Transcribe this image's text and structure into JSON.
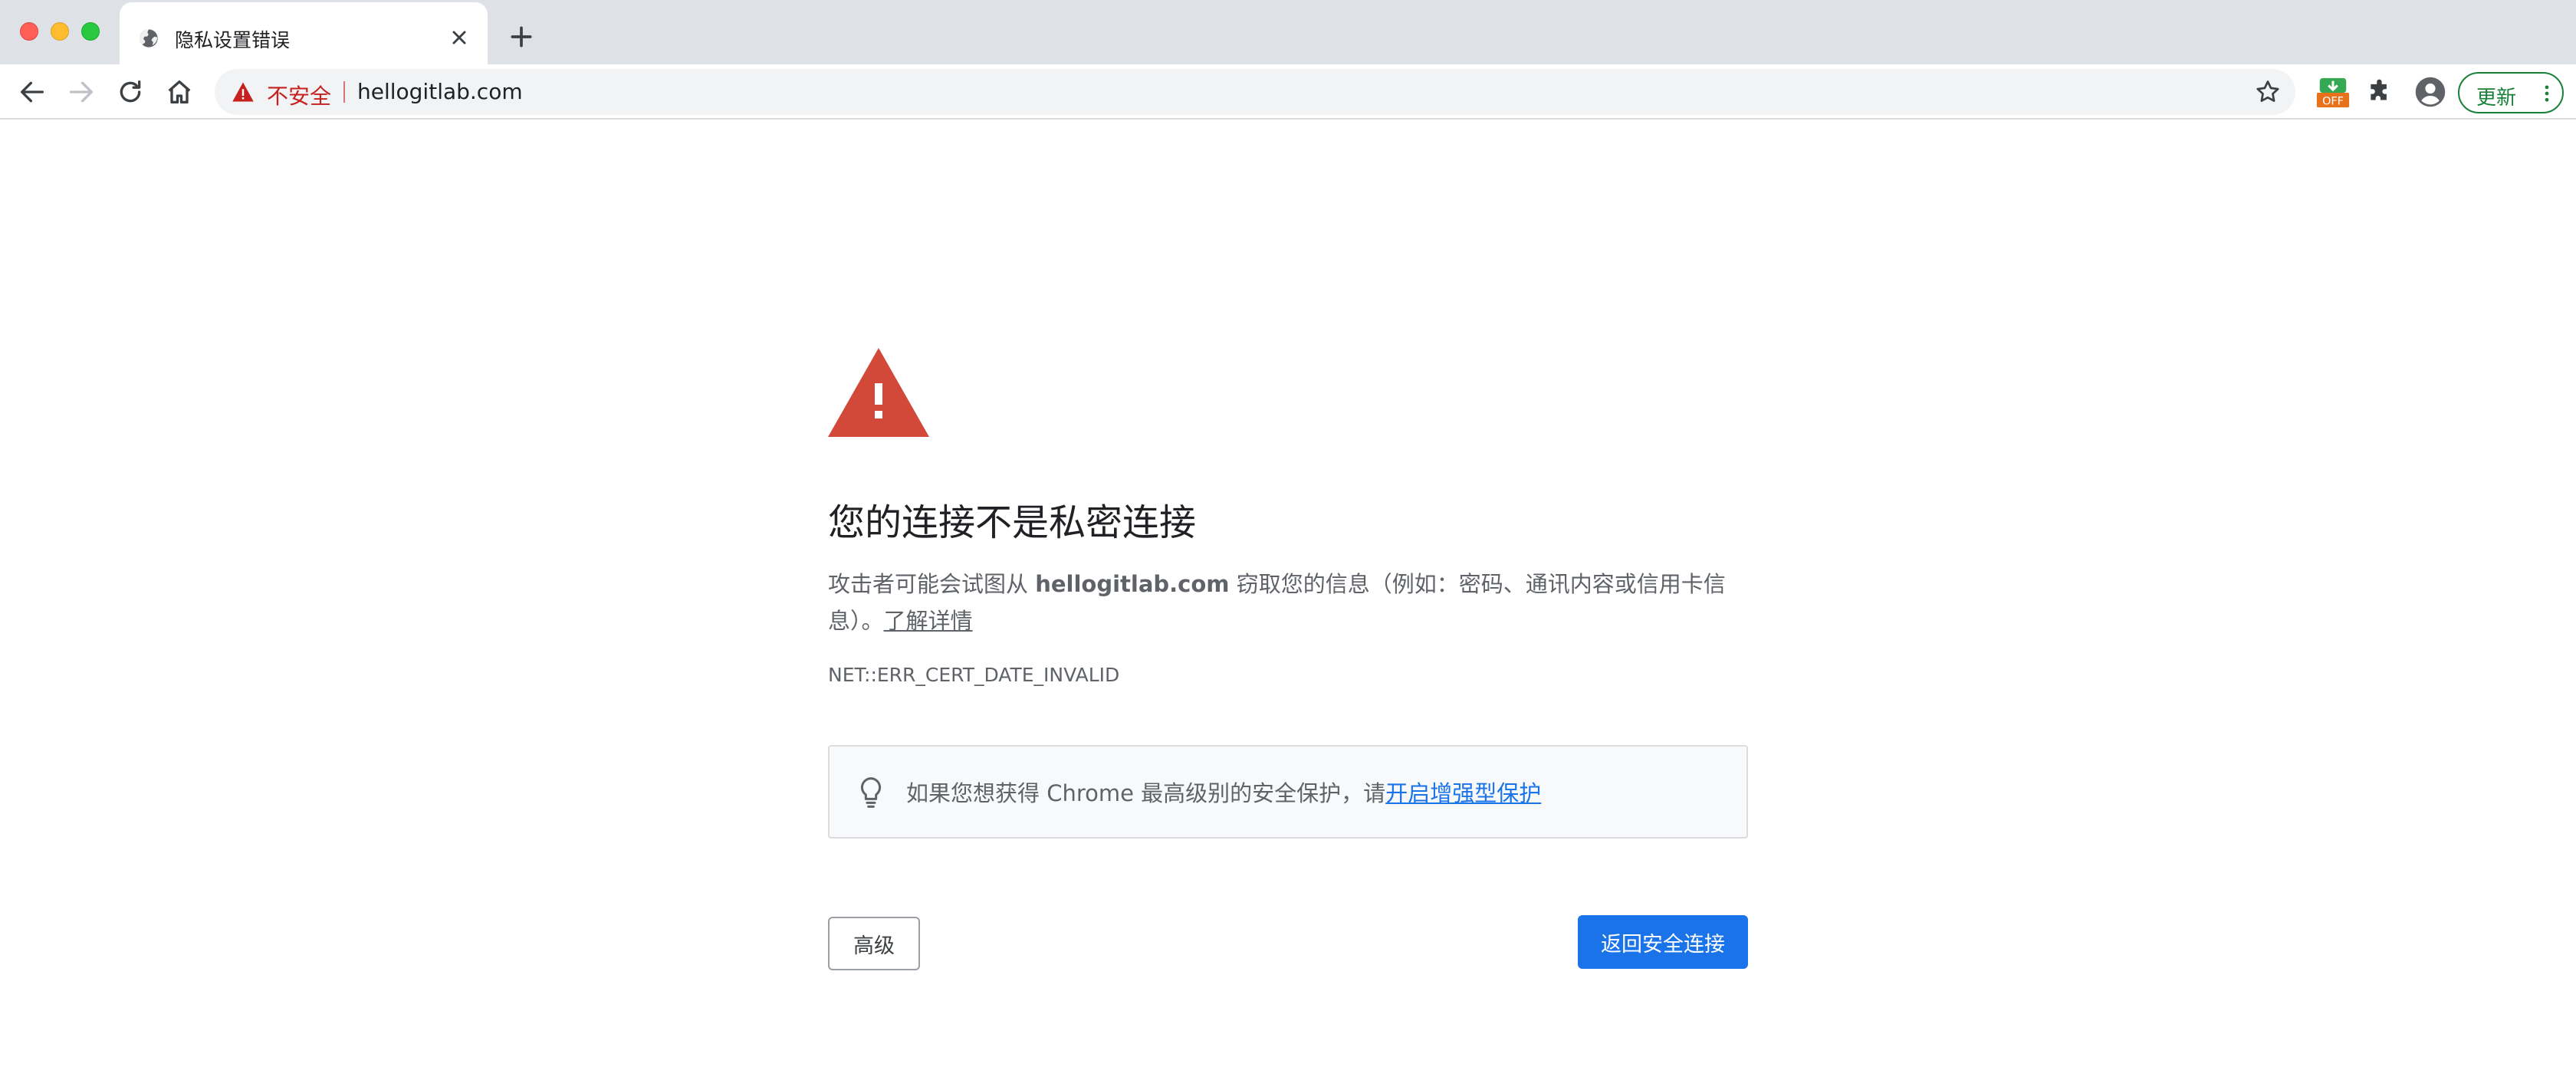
{
  "browser": {
    "tab": {
      "title": "隐私设置错误",
      "favicon": "globe-icon",
      "close_icon": "close-icon"
    },
    "new_tab_icon": "plus-icon",
    "toolbar": {
      "back_icon": "back-arrow-icon",
      "forward_icon": "forward-arrow-icon",
      "reload_icon": "reload-icon",
      "home_icon": "home-icon"
    },
    "omnibox": {
      "security_icon": "warning-triangle-icon",
      "security_label": "不安全",
      "url": "hellogitlab.com",
      "bookmark_icon": "star-icon"
    },
    "extensions": {
      "ext_badge": "OFF",
      "puzzle_icon": "puzzle-icon"
    },
    "profile_icon": "account-circle-icon",
    "update_button": {
      "label": "更新",
      "menu_icon": "kebab-menu-icon"
    }
  },
  "interstitial": {
    "icon": "warning-triangle-icon",
    "heading": "您的连接不是私密连接",
    "explanation_prefix": "攻击者可能会试图从 ",
    "explanation_host": "hellogitlab.com",
    "explanation_suffix": " 窃取您的信息（例如：密码、通讯内容或信用卡信息）。",
    "learn_more": "了解详情",
    "error_code": "NET::ERR_CERT_DATE_INVALID",
    "promo": {
      "icon": "lightbulb-icon",
      "text": "如果您想获得 Chrome 最高级别的安全保护，请",
      "link": "开启增强型保护"
    },
    "advanced_button": "高级",
    "back_button": "返回安全连接"
  },
  "colors": {
    "danger": "#c5221f",
    "warning_triangle": "#d2493a",
    "primary_blue": "#1a73e8",
    "update_green": "#188038",
    "tabstrip_bg": "#dee1e6",
    "text_secondary": "#5f6368"
  }
}
